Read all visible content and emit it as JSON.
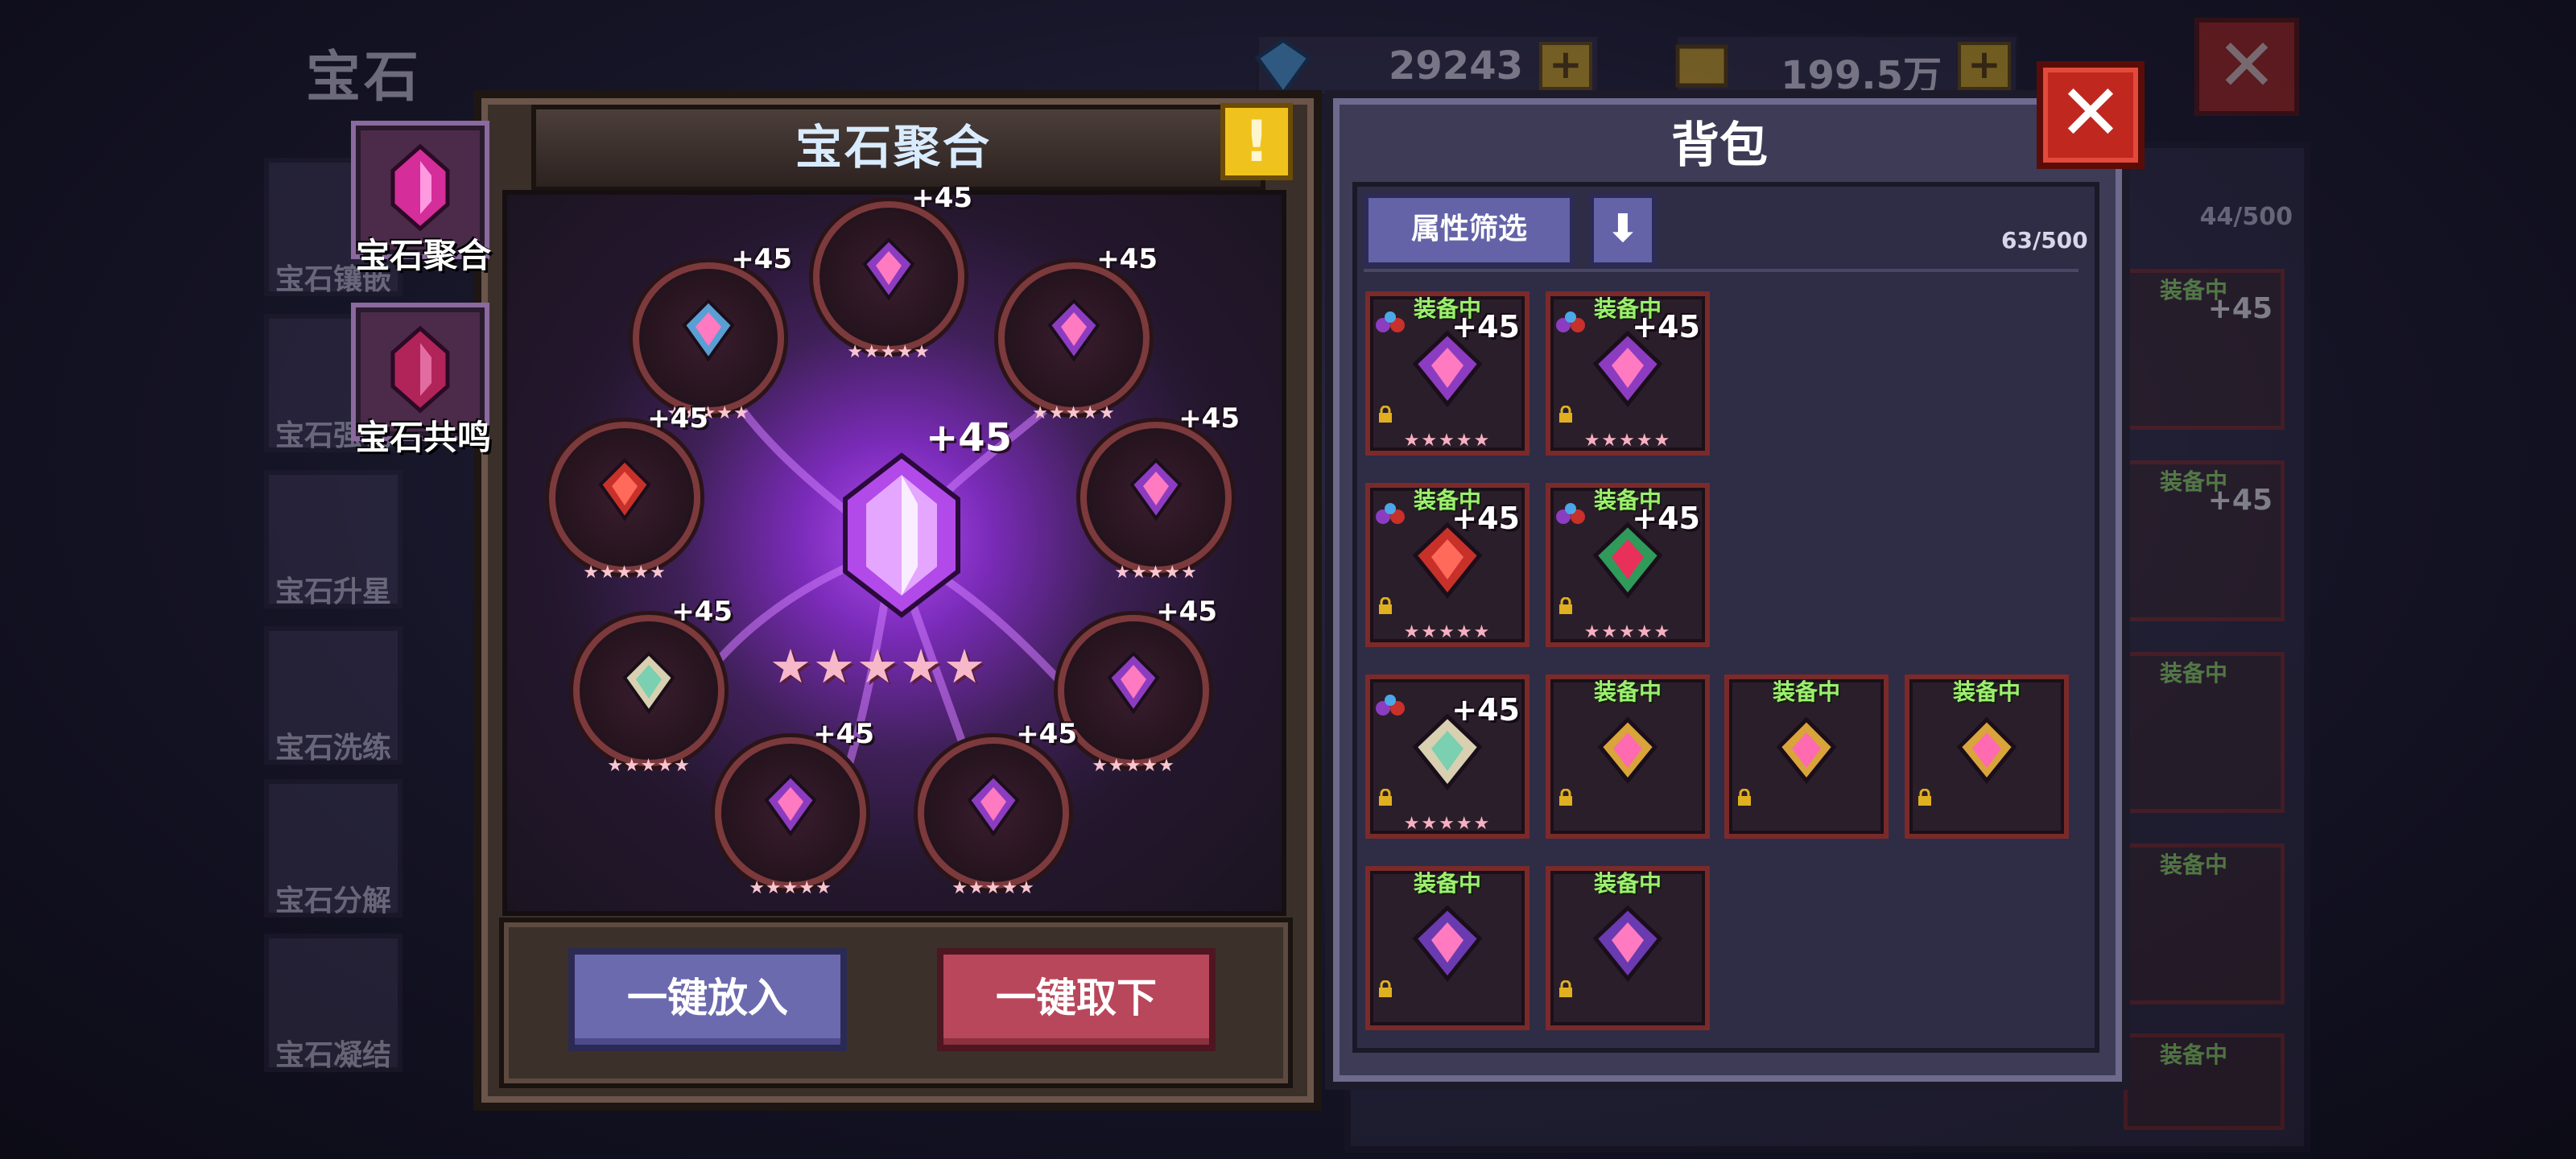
{
  "background": {
    "title": "宝石",
    "side_tabs": [
      "宝石镶嵌",
      "宝石强化",
      "宝石升星",
      "宝石洗练",
      "宝石分解",
      "宝石凝结"
    ],
    "diamond_amount": "29243",
    "gold_amount": "199.5万",
    "close_symbol": "✕",
    "right_panel_count": "44/500",
    "right_panel_equip_label": "装备中",
    "right_panel_level": "+45"
  },
  "tabs": [
    {
      "label": "宝石聚合",
      "active": true
    },
    {
      "label": "宝石共鸣",
      "active": false
    }
  ],
  "fusion": {
    "title": "宝石聚合",
    "info_symbol": "!",
    "center_level": "+45",
    "center_stars": "★★★★★",
    "slots": [
      {
        "level": "+45",
        "stars": "★★★★★",
        "gem_color": "#8c3cc0"
      },
      {
        "level": "+45",
        "stars": "★★★★★",
        "gem_color": "#5a9fd4"
      },
      {
        "level": "+45",
        "stars": "★★★★★",
        "gem_color": "#8c3cc0"
      },
      {
        "level": "+45",
        "stars": "★★★★★",
        "gem_color": "#c8302a"
      },
      {
        "level": "+45",
        "stars": "★★★★★",
        "gem_color": "#8c3cc0"
      },
      {
        "level": "+45",
        "stars": "★★★★★",
        "gem_color": "#d8d0b0"
      },
      {
        "level": "+45",
        "stars": "★★★★★",
        "gem_color": "#8c3cc0"
      },
      {
        "level": "+45",
        "stars": "★★★★★",
        "gem_color": "#8c3cc0"
      },
      {
        "level": "+45",
        "stars": "★★★★★",
        "gem_color": "#8c3cc0"
      }
    ],
    "put_all_button": "一键放入",
    "take_all_button": "一键取下"
  },
  "bag": {
    "title": "背包",
    "filter_button": "属性筛选",
    "sort_symbol": "⬇",
    "count": "63/500",
    "close_symbol": "✕",
    "items": [
      {
        "equip": "装备中",
        "level": "+45",
        "stars": "★★★★★",
        "gem_color": "#8c3cc0",
        "mini": true
      },
      {
        "equip": "装备中",
        "level": "+45",
        "stars": "★★★★★",
        "gem_color": "#8c3cc0",
        "mini": true
      },
      {
        "equip": "装备中",
        "level": "+45",
        "stars": "★★★★★",
        "gem_color": "#c8302a",
        "mini": true
      },
      {
        "equip": "装备中",
        "level": "+45",
        "stars": "★★★★★",
        "gem_color": "#2f9a5a",
        "mini": true
      },
      {
        "equip": "",
        "level": "+45",
        "stars": "★★★★★",
        "gem_color": "#d8d0b0",
        "mini": true
      },
      {
        "equip": "装备中",
        "level": "",
        "stars": "",
        "gem_color": "#d9a43a",
        "mini": false
      },
      {
        "equip": "装备中",
        "level": "",
        "stars": "",
        "gem_color": "#d9a43a",
        "mini": false
      },
      {
        "equip": "装备中",
        "level": "",
        "stars": "",
        "gem_color": "#d9a43a",
        "mini": false
      },
      {
        "equip": "装备中",
        "level": "",
        "stars": "",
        "gem_color": "#6a3ab0",
        "mini": false
      },
      {
        "equip": "装备中",
        "level": "",
        "stars": "",
        "gem_color": "#6a3ab0",
        "mini": false
      }
    ]
  },
  "colors": {
    "accent_purple": "#6463a8",
    "accent_red": "#b8475b",
    "equip_green": "#9cf06e"
  }
}
